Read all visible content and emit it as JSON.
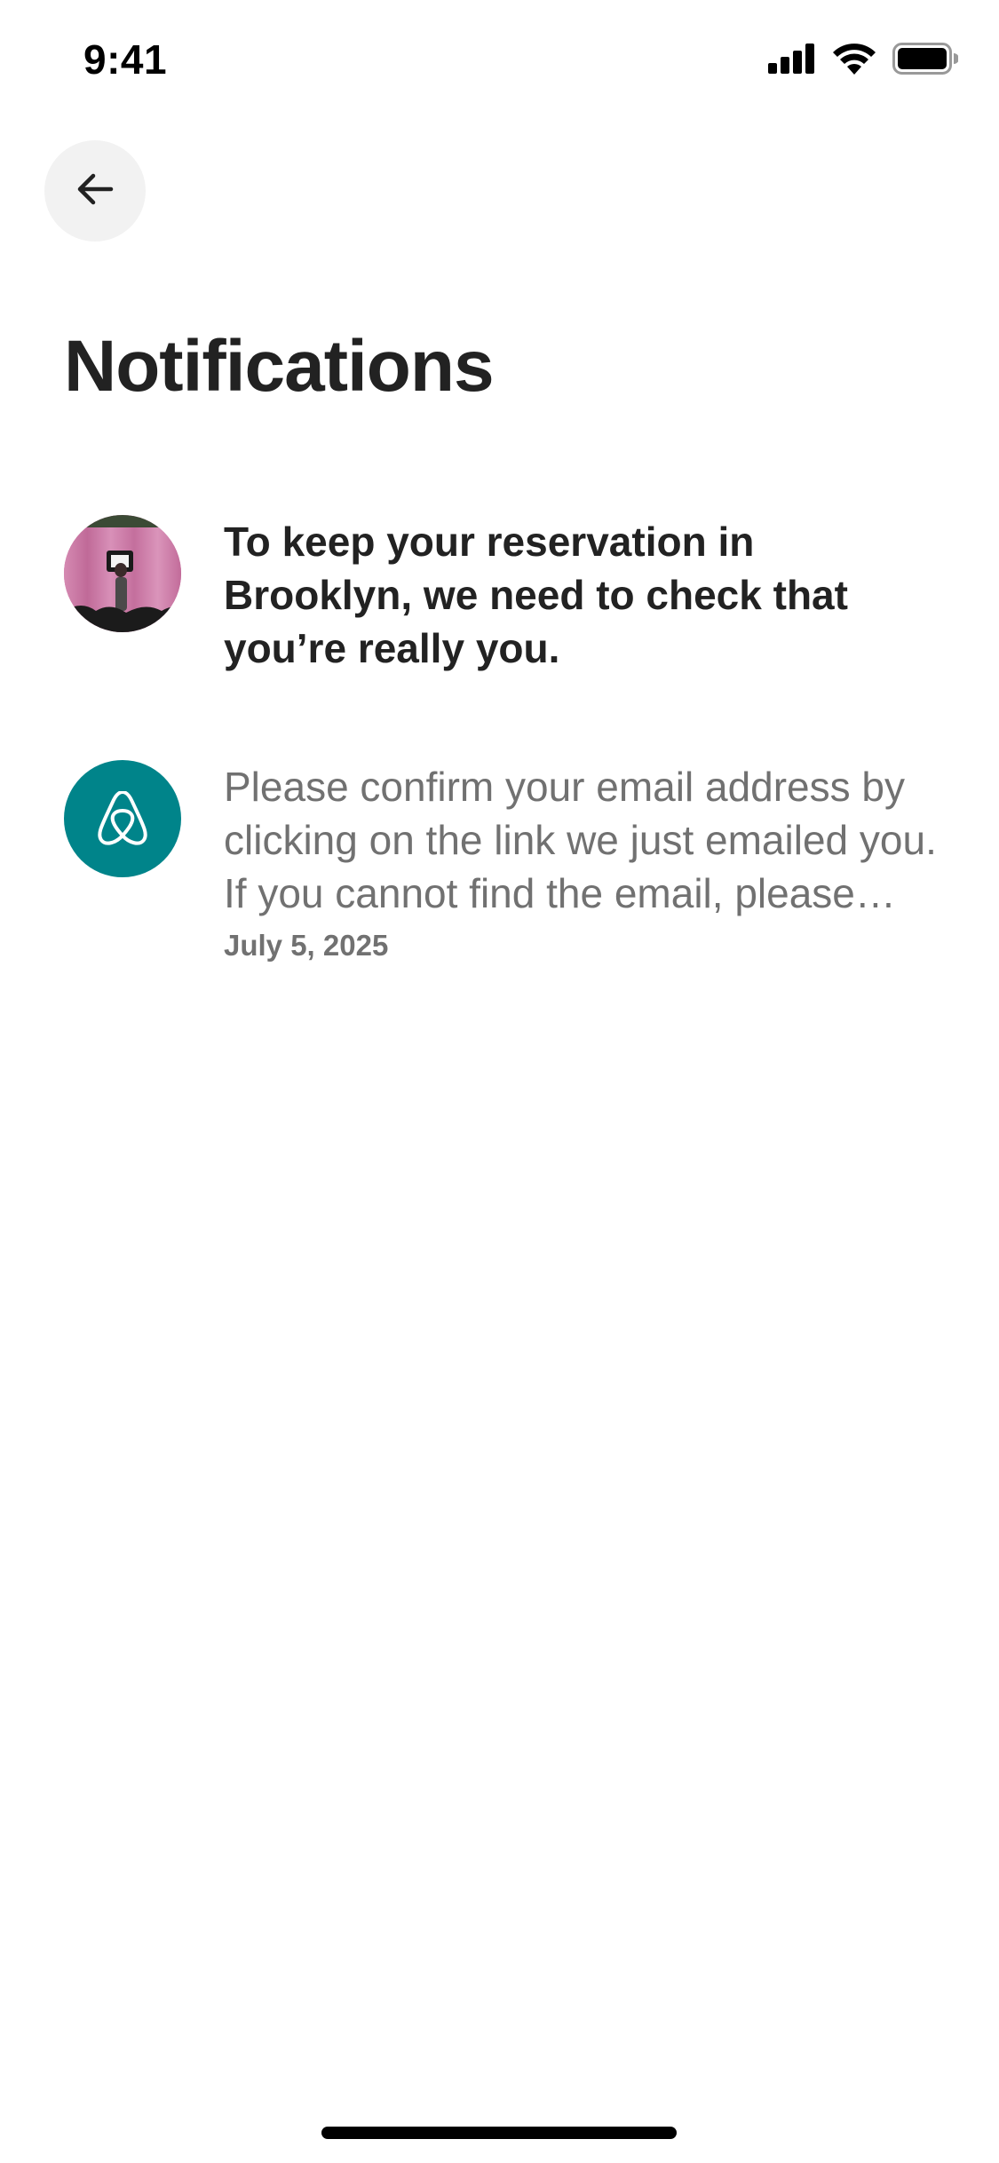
{
  "status_bar": {
    "time": "9:41",
    "icons": [
      "cellular-signal-icon",
      "wifi-icon",
      "battery-icon"
    ]
  },
  "header": {
    "back_icon": "arrow-left-icon",
    "title": "Notifications"
  },
  "notifications": [
    {
      "avatar": "listing-photo-avatar",
      "text": "To keep your reservation in Brooklyn, we need to check that you’re really you.",
      "unread": true
    },
    {
      "avatar": "airbnb-logo-icon",
      "text": "Please confirm your email address by clicking on the link we just emailed you. If you cannot find the email, please check your spam folder.",
      "date": "July 5, 2025",
      "unread": false
    }
  ],
  "colors": {
    "title": "#222222",
    "muted_text": "#717171",
    "brand_teal": "#00848a",
    "back_button_bg": "#f2f2f2"
  }
}
